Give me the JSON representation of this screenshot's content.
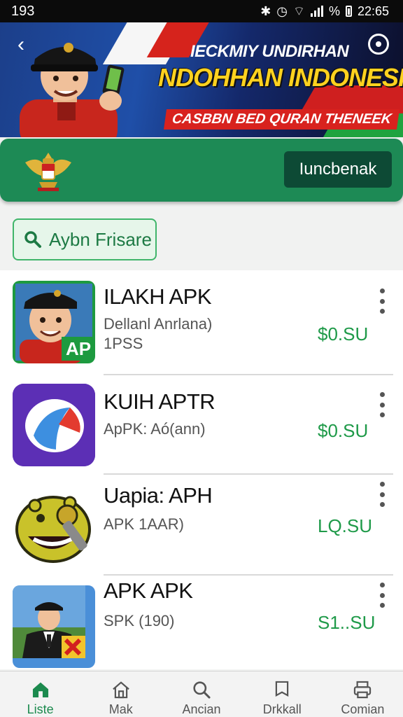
{
  "status_bar": {
    "left_time": "193",
    "right_time": "22:65",
    "percent_icon": "%"
  },
  "banner": {
    "line1": "IECKMIY UNDIRHAN",
    "line2": "NDOHHAN INDONESIA",
    "line3": "CASBBN BED QURAN THENEEK"
  },
  "header": {
    "action_label": "Iuncbenak"
  },
  "search": {
    "label": "Aybn Frisare"
  },
  "apps": [
    {
      "title": "ILAKH APK",
      "subtitle": "Dellanl Anrlana)",
      "meta": "1PSS",
      "price": "$0.SU",
      "badge": "AP"
    },
    {
      "title": "KUIH APTR",
      "subtitle": "ApPK: Aó(ann)",
      "meta": "",
      "price": "$0.SU"
    },
    {
      "title": "Uapia: APH",
      "subtitle": "APK 1AAR)",
      "meta": "",
      "price": "LQ.SU"
    },
    {
      "title": "APK  APK",
      "subtitle": "SPK (190)",
      "meta": "",
      "price": "S1..SU"
    }
  ],
  "nav": [
    {
      "label": "Liste",
      "icon": "home-icon",
      "active": true
    },
    {
      "label": "Mak",
      "icon": "house-outline-icon",
      "active": false
    },
    {
      "label": "Ancian",
      "icon": "search-icon",
      "active": false
    },
    {
      "label": "Drkkall",
      "icon": "bookmark-icon",
      "active": false
    },
    {
      "label": "Comian",
      "icon": "printer-icon",
      "active": false
    }
  ],
  "colors": {
    "green": "#1d8a55",
    "dark_green": "#0d4a35",
    "price_green": "#1f9a49",
    "accent_yellow": "#ffd21f",
    "accent_red": "#d8221e"
  }
}
